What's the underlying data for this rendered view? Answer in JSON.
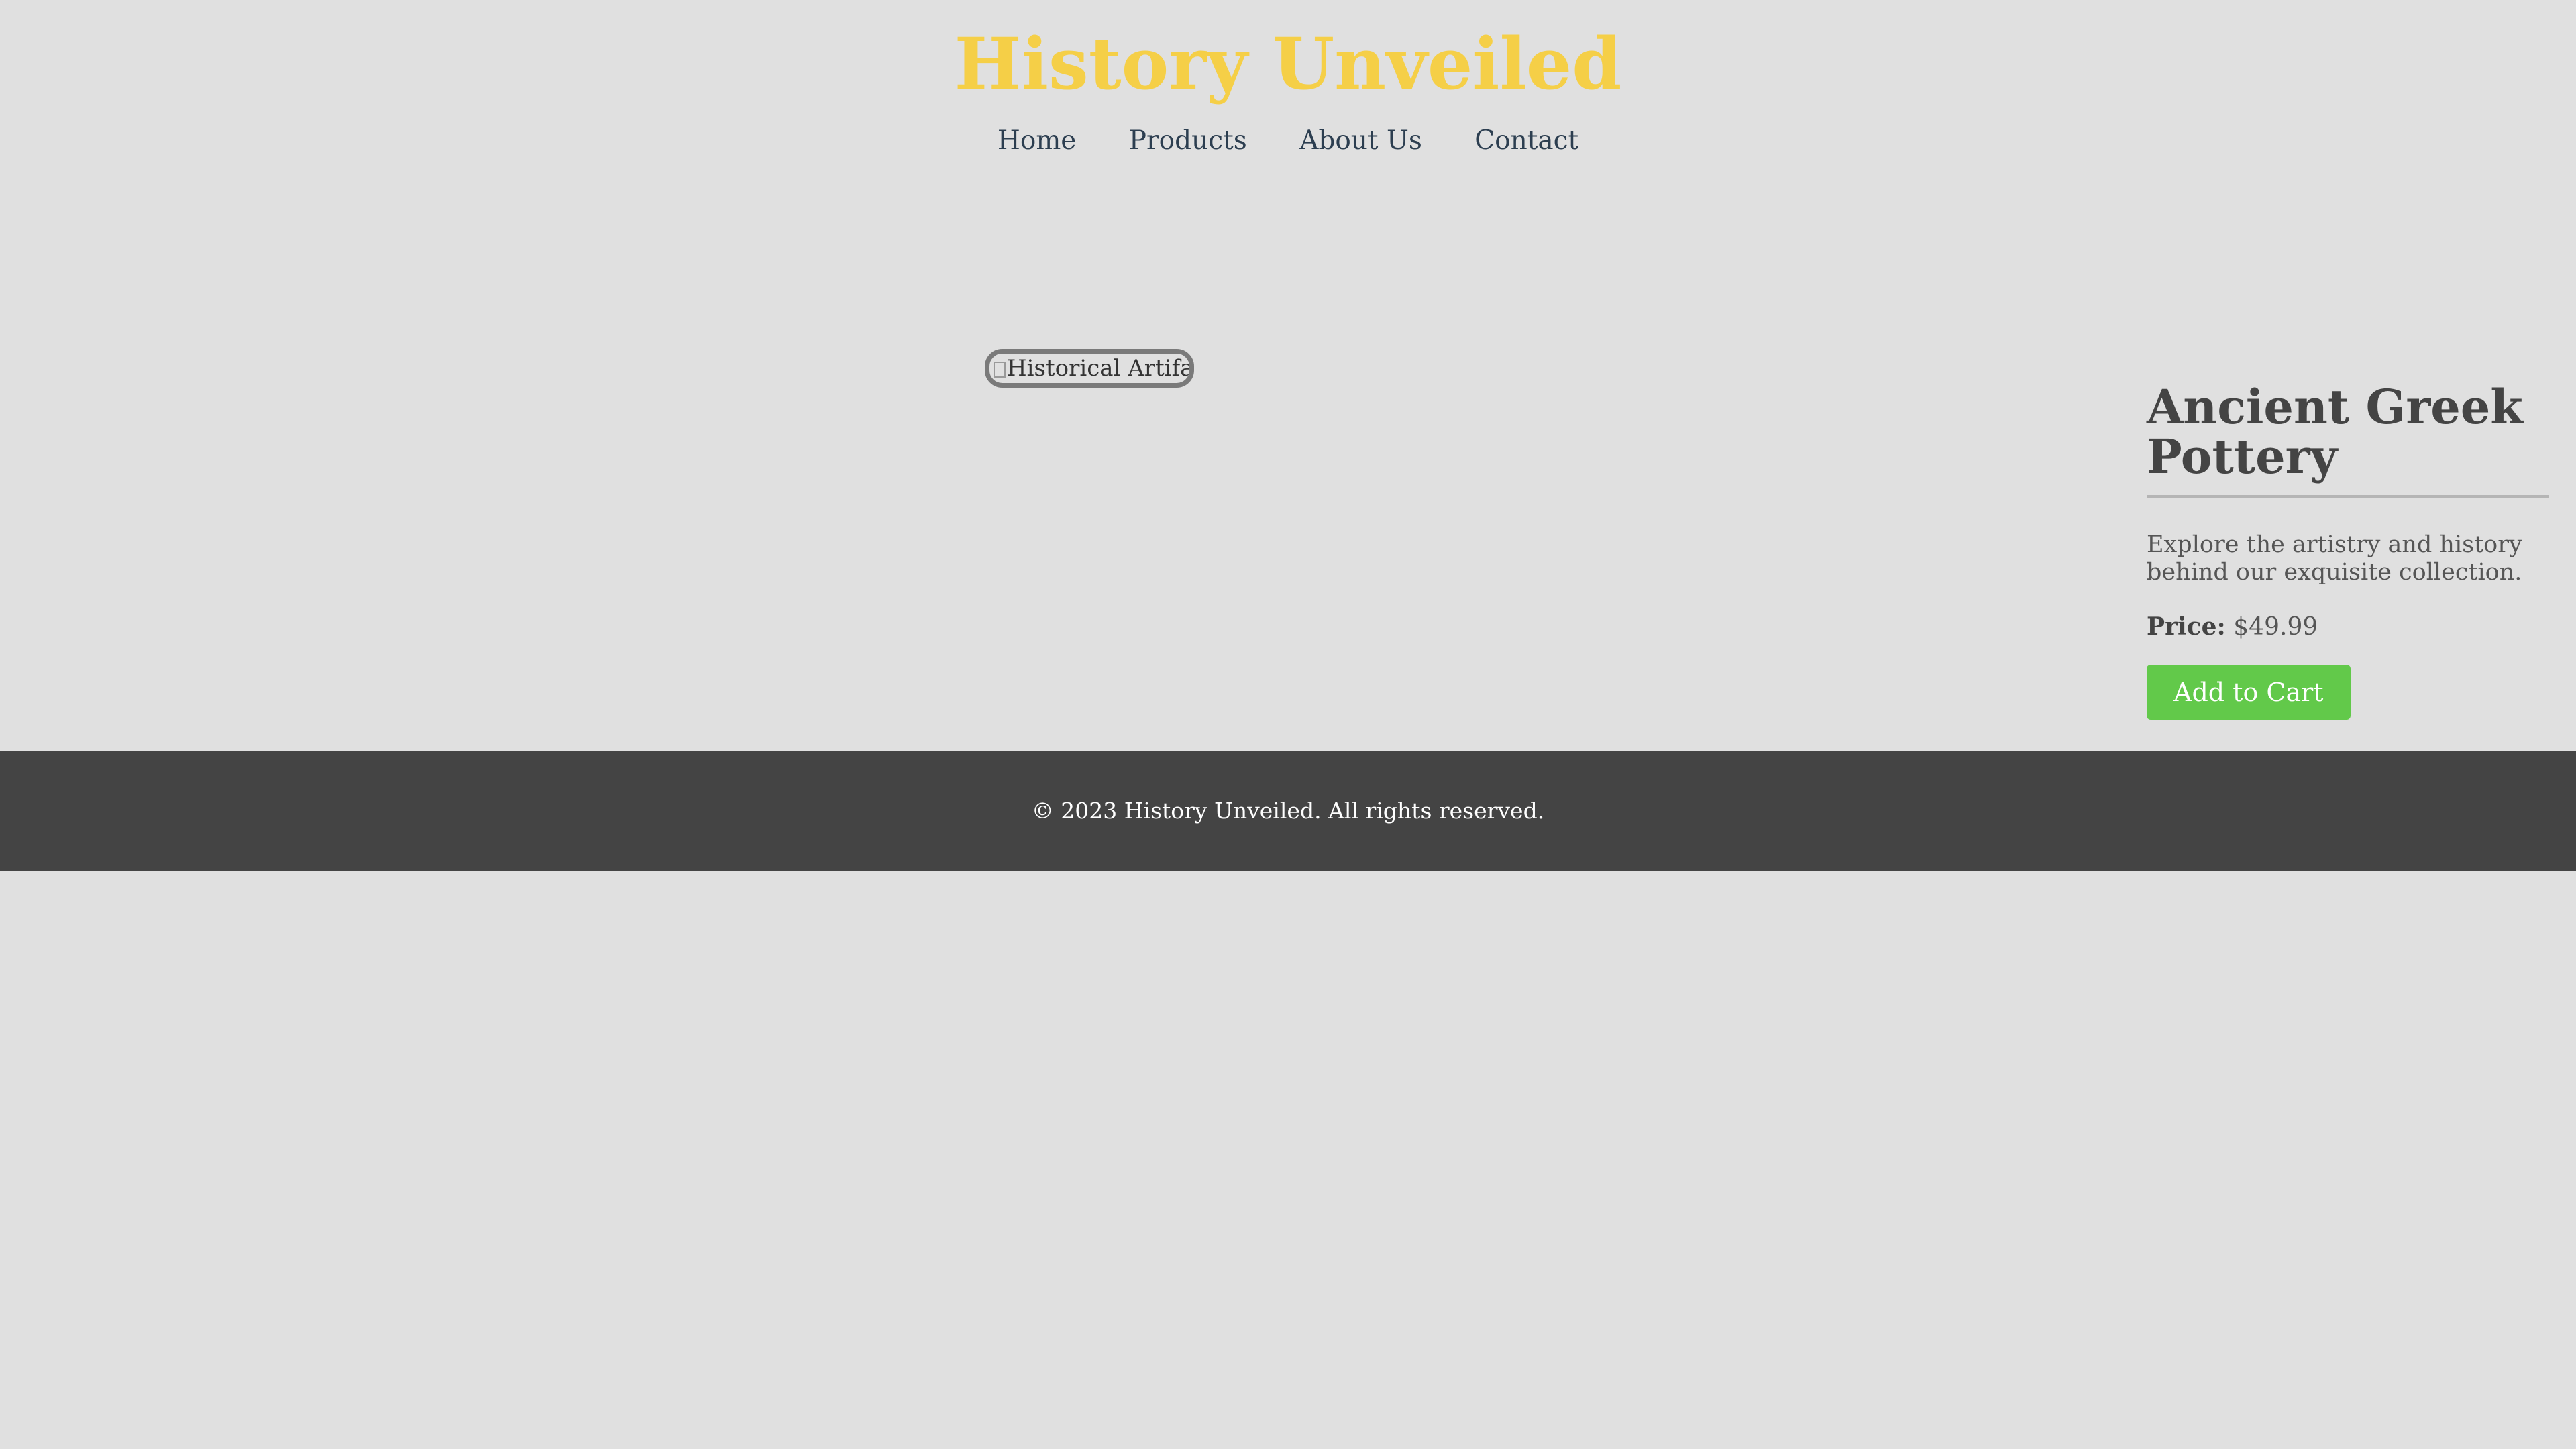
{
  "header": {
    "title": "History Unveiled",
    "nav": [
      "Home",
      "Products",
      "About Us",
      "Contact"
    ]
  },
  "main": {
    "image_alt": "Historical Artifact",
    "product": {
      "title": "Ancient Greek Pottery",
      "description": "Explore the artistry and history behind our exquisite collection.",
      "price_label": "Price:",
      "price_value": "$49.99",
      "cart_button": "Add to Cart"
    }
  },
  "footer": {
    "copyright": "© 2023 History Unveiled. All rights reserved."
  },
  "colors": {
    "title": "#f5cf47",
    "nav_link": "#2c3e50",
    "background": "#e0e0e0",
    "footer_bg": "#444444",
    "button": "#62c94a"
  }
}
